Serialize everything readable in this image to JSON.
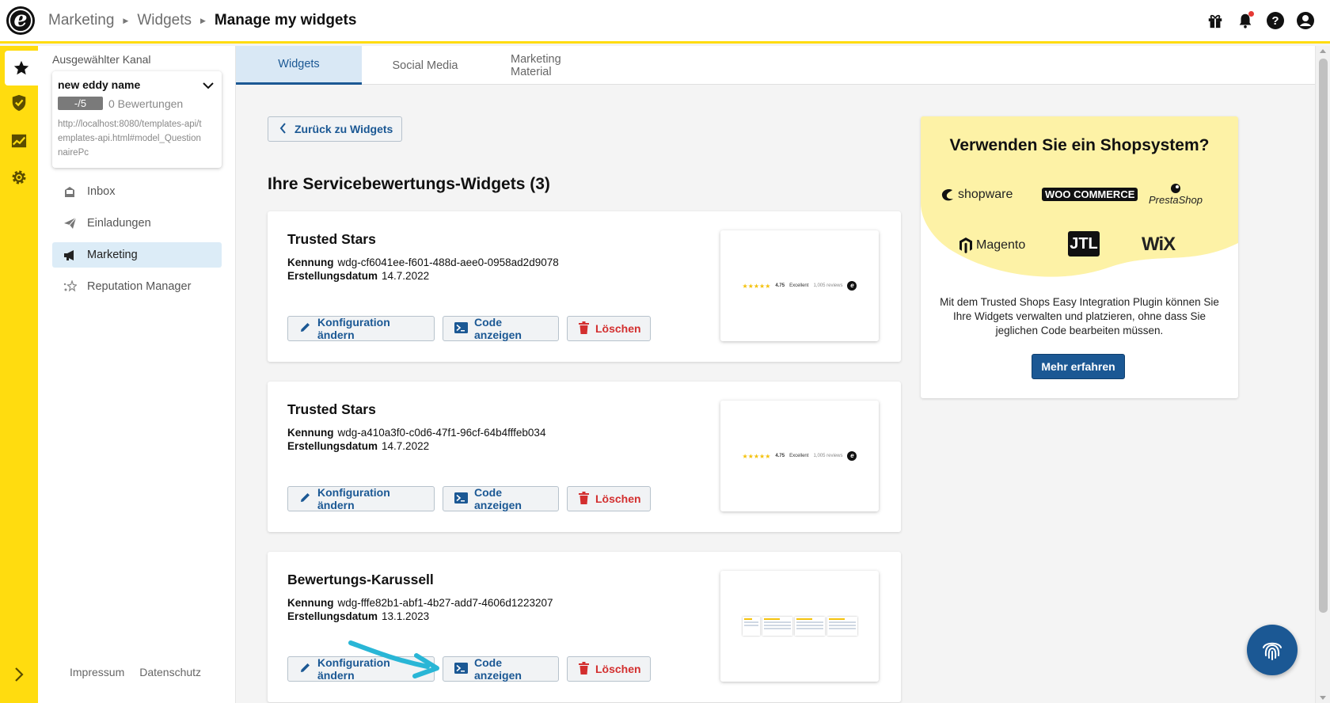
{
  "header": {
    "breadcrumb": [
      "Marketing",
      "Widgets",
      "Manage my widgets"
    ],
    "icons": [
      "gift-icon",
      "bell-icon",
      "help-icon",
      "user-icon"
    ]
  },
  "rail": {
    "items": [
      "star-icon",
      "shield-icon",
      "chart-icon",
      "gear-icon"
    ],
    "active": "star-icon"
  },
  "sidebar": {
    "channel_label": "Ausgewählter Kanal",
    "channel_name": "new eddy name",
    "rating": "-/5",
    "reviews": "0 Bewertungen",
    "url": "http://localhost:8080/templates-api/templates-api.html#model_QuestionnairePc",
    "nav": [
      {
        "label": "Inbox",
        "icon": "inbox-icon"
      },
      {
        "label": "Einladungen",
        "icon": "paper-plane-icon"
      },
      {
        "label": "Marketing",
        "icon": "megaphone-icon",
        "active": true
      },
      {
        "label": "Reputation Manager",
        "icon": "sparkle-icon"
      }
    ],
    "footer": [
      "Impressum",
      "Datenschutz"
    ]
  },
  "tabs": [
    "Widgets",
    "Social Media",
    "Marketing Material"
  ],
  "main": {
    "back_label": "Zurück zu Widgets",
    "section_title": "Ihre Servicebewertungs-Widgets (3)",
    "labels": {
      "id": "Kennung",
      "created": "Erstellungsdatum"
    },
    "actions": {
      "edit": "Konfiguration ändern",
      "code": "Code anzeigen",
      "delete": "Löschen"
    },
    "widgets": [
      {
        "title": "Trusted Stars",
        "id": "wdg-cf6041ee-f601-488d-aee0-0958ad2d9078",
        "created": "14.7.2022",
        "preview": "stars"
      },
      {
        "title": "Trusted Stars",
        "id": "wdg-a410a3f0-c0d6-47f1-96cf-64b4fffeb034",
        "created": "14.7.2022",
        "preview": "stars"
      },
      {
        "title": "Bewertungs-Karussell",
        "id": "wdg-fffe82b1-abf1-4b27-add7-4606d1223207",
        "created": "13.1.2023",
        "preview": "carousel"
      }
    ],
    "preview_text": {
      "score": "4.75",
      "grade": "Excellent",
      "reviews": "1,005 reviews"
    }
  },
  "promo": {
    "title": "Verwenden Sie ein Shopsystem?",
    "logos": [
      "shopware",
      "WOO COMMERCE",
      "PrestaShop",
      "Magento",
      "JTL",
      "WiX"
    ],
    "text": "Mit dem Trusted Shops Easy Integration Plugin können Sie Ihre Widgets verwalten und platzieren, ohne dass Sie jeglichen Code bearbeiten müssen.",
    "button": "Mehr erfahren"
  },
  "colors": {
    "brand_yellow": "#ffdc0f",
    "primary_blue": "#1b5894",
    "danger": "#d32f2f"
  }
}
